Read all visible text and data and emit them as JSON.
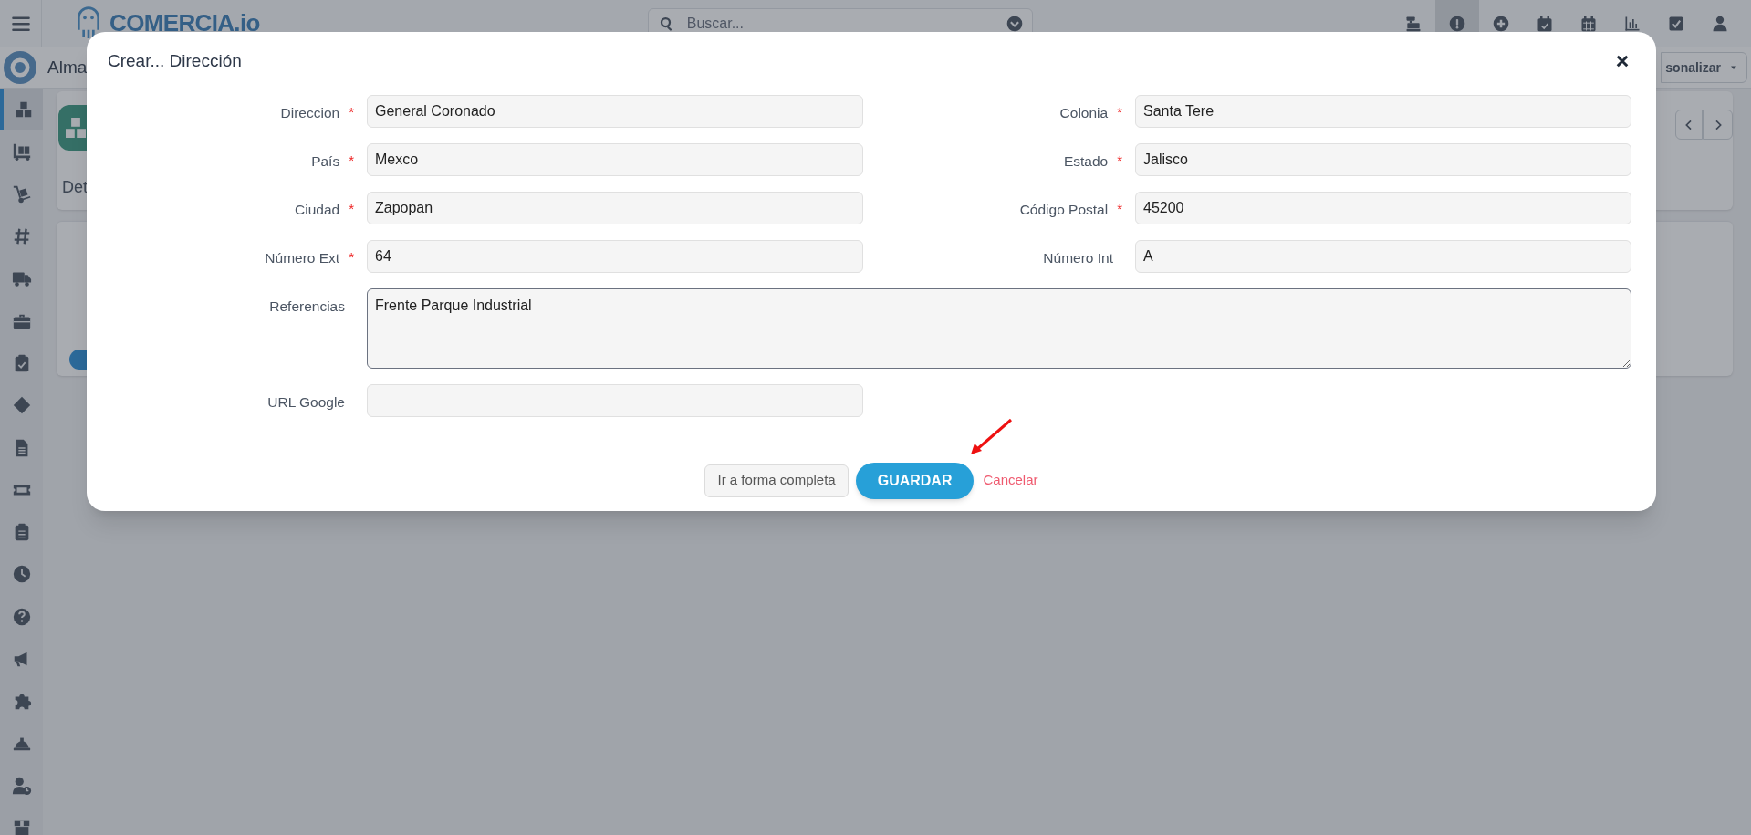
{
  "topbar": {
    "logo": "COMERCIA.io",
    "search": {
      "placeholder": "Buscar..."
    },
    "icons": [
      {
        "selected": false
      },
      {
        "selected": true
      },
      {
        "selected": false
      },
      {
        "selected": false
      },
      {
        "selected": false
      },
      {
        "selected": false
      },
      {
        "selected": false
      },
      {
        "selected": false
      }
    ]
  },
  "subbar": {
    "title": "Alma",
    "customize_button": "sonalizar"
  },
  "sidebar": {
    "items": [
      {
        "selected": true
      },
      {
        "selected": false
      },
      {
        "selected": false
      },
      {
        "selected": false
      },
      {
        "selected": false
      },
      {
        "selected": false
      },
      {
        "selected": false
      },
      {
        "selected": false
      },
      {
        "selected": false
      },
      {
        "selected": false
      },
      {
        "selected": false
      },
      {
        "selected": false
      },
      {
        "selected": false
      },
      {
        "selected": false
      },
      {
        "selected": false
      },
      {
        "selected": false
      },
      {
        "selected": false
      },
      {
        "selected": false
      }
    ]
  },
  "background_tab": "Det",
  "background_toggle": {
    "on": true
  },
  "dialog": {
    "title": "Crear... Dirección",
    "required_mark": "*",
    "fields": [
      {
        "kind": "input",
        "label": "Direccion",
        "required": true,
        "value": "General Coronado"
      },
      {
        "kind": "input",
        "label": "Colonia",
        "required": true,
        "value": "Santa Tere"
      },
      {
        "kind": "input",
        "label": "País",
        "required": true,
        "value": "Mexco"
      },
      {
        "kind": "input",
        "label": "Estado",
        "required": true,
        "value": "Jalisco"
      },
      {
        "kind": "input",
        "label": "Ciudad",
        "required": true,
        "value": "Zapopan"
      },
      {
        "kind": "input",
        "label": "Código Postal",
        "required": true,
        "value": "45200"
      },
      {
        "kind": "input",
        "label": "Número Ext",
        "required": true,
        "value": "64"
      },
      {
        "kind": "input",
        "label": "Número Int",
        "required": false,
        "value": "A"
      },
      {
        "kind": "textarea",
        "label": "Referencias",
        "required": false,
        "value": "Frente Parque Industrial"
      },
      {
        "kind": "input",
        "label": "URL Google",
        "required": false
      }
    ],
    "buttons": [
      {
        "kind": "secondary",
        "label": "Ir a forma completa"
      },
      {
        "kind": "primary",
        "label": "GUARDAR"
      },
      {
        "kind": "link",
        "label": "Cancelar"
      }
    ]
  }
}
